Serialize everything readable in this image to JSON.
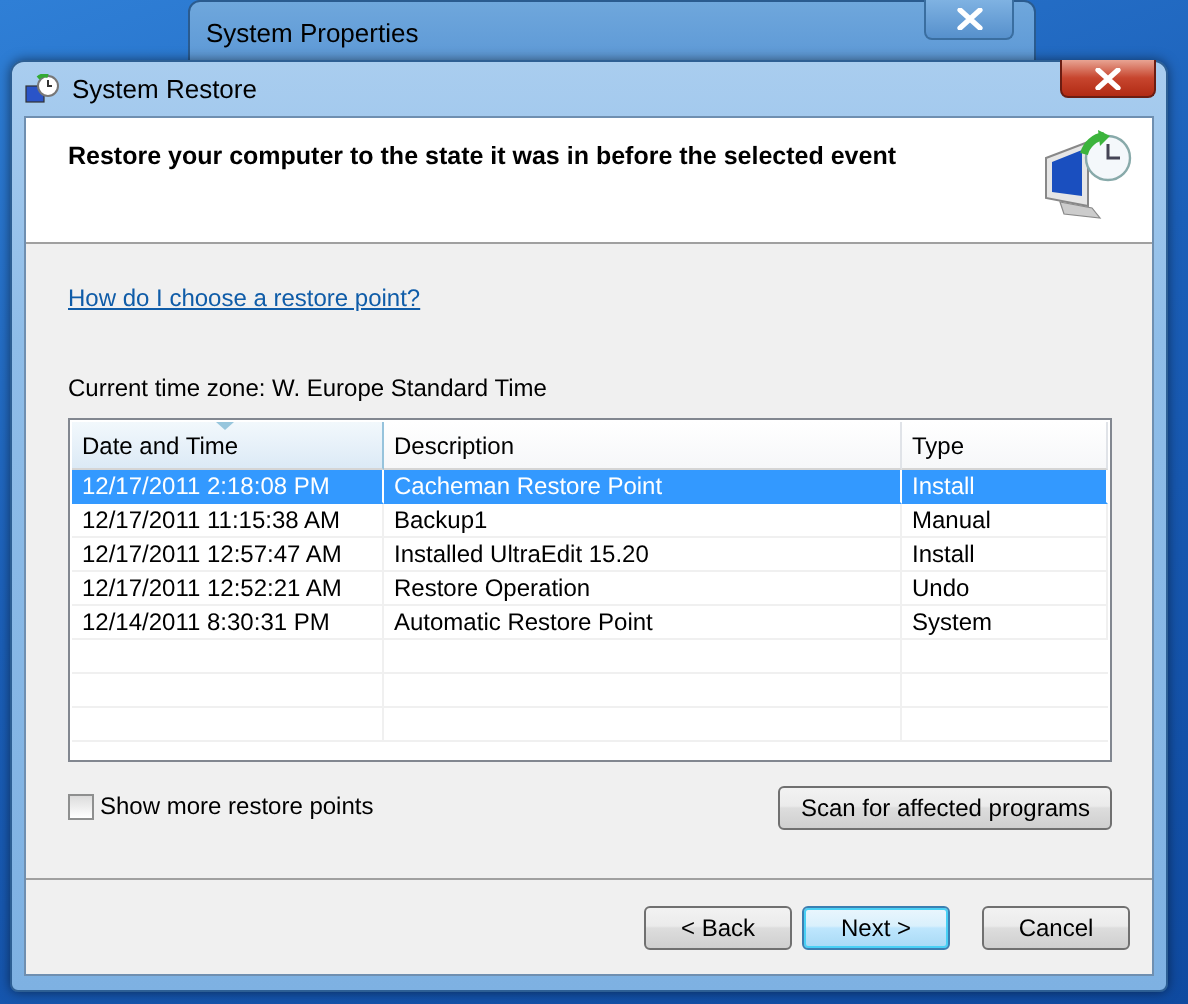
{
  "background_window": {
    "title": "System Properties"
  },
  "dialog": {
    "title": "System Restore",
    "heading": "Restore your computer to the state it was in before the selected event",
    "help_link": "How do I choose a restore point?",
    "time_zone": "Current time zone: W. Europe Standard Time",
    "table": {
      "columns": [
        {
          "label": "Date and Time",
          "sorted": true
        },
        {
          "label": "Description",
          "sorted": false
        },
        {
          "label": "Type",
          "sorted": false
        }
      ],
      "rows": [
        {
          "cells": [
            "12/17/2011 2:18:08 PM",
            "Cacheman Restore Point",
            "Install"
          ],
          "selected": true
        },
        {
          "cells": [
            "12/17/2011 11:15:38 AM",
            "Backup1",
            "Manual"
          ],
          "selected": false
        },
        {
          "cells": [
            "12/17/2011 12:57:47 AM",
            "Installed UltraEdit 15.20",
            "Install"
          ],
          "selected": false
        },
        {
          "cells": [
            "12/17/2011 12:52:21 AM",
            "Restore Operation",
            "Undo"
          ],
          "selected": false
        },
        {
          "cells": [
            "12/14/2011 8:30:31 PM",
            "Automatic Restore Point",
            "System"
          ],
          "selected": false
        }
      ]
    },
    "show_more": {
      "label": "Show more restore points",
      "checked": false
    },
    "scan_button": "Scan for affected programs",
    "buttons": [
      {
        "label": "< Back",
        "default": false
      },
      {
        "label": "Next >",
        "default": true
      },
      {
        "label": "Cancel",
        "default": false
      }
    ]
  }
}
